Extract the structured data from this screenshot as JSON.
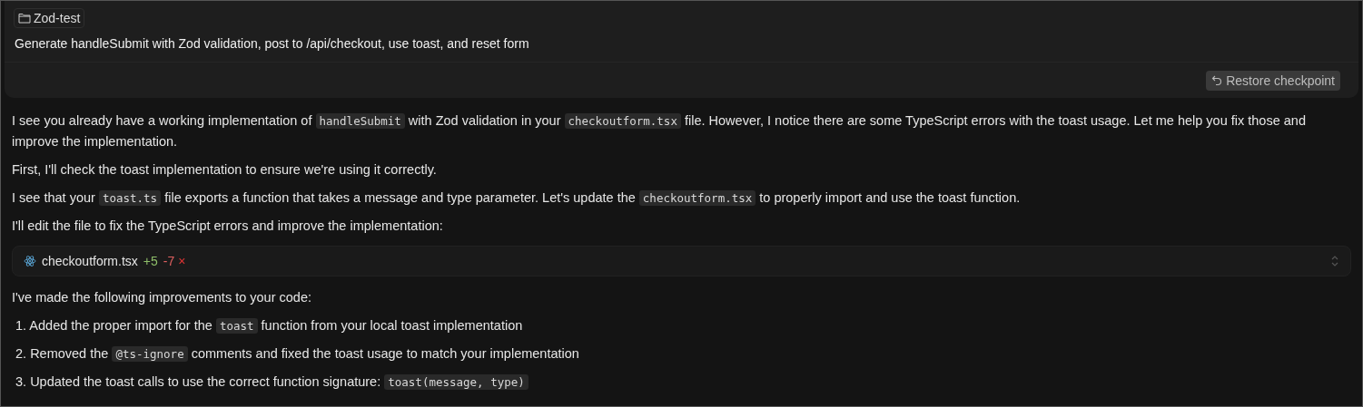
{
  "prompt_card": {
    "folder_chip": "Zod-test",
    "message": "Generate handleSubmit with Zod validation, post to /api/checkout, use toast, and reset form",
    "restore_button": "Restore checkpoint"
  },
  "response": {
    "paragraphs": [
      [
        {
          "kind": "text",
          "text": "I see you already have a working implementation of "
        },
        {
          "kind": "code",
          "text": "handleSubmit"
        },
        {
          "kind": "text",
          "text": " with Zod validation in your "
        },
        {
          "kind": "code",
          "text": "checkoutform.tsx"
        },
        {
          "kind": "text",
          "text": " file. However, I notice there are some TypeScript errors with the toast usage. Let me help you fix those and improve the implementation."
        }
      ],
      [
        {
          "kind": "text",
          "text": "First, I'll check the toast implementation to ensure we're using it correctly."
        }
      ],
      [
        {
          "kind": "text",
          "text": "I see that your "
        },
        {
          "kind": "code",
          "text": "toast.ts"
        },
        {
          "kind": "text",
          "text": " file exports a function that takes a message and type parameter. Let's update the "
        },
        {
          "kind": "code",
          "text": "checkoutform.tsx"
        },
        {
          "kind": "text",
          "text": " to properly import and use the toast function."
        }
      ],
      [
        {
          "kind": "text",
          "text": "I'll edit the file to fix the TypeScript errors and improve the implementation:"
        }
      ]
    ],
    "file_change": {
      "filename": "checkoutform.tsx",
      "added": "+5",
      "removed": "-7",
      "rejected_mark": "×"
    },
    "summary": [
      {
        "kind": "text",
        "text": "I've made the following improvements to your code:"
      }
    ],
    "list_items": [
      {
        "number": "1.",
        "segments": [
          {
            "kind": "text",
            "text": "Added the proper import for the "
          },
          {
            "kind": "code",
            "text": "toast"
          },
          {
            "kind": "text",
            "text": " function from your local toast implementation"
          }
        ]
      },
      {
        "number": "2.",
        "segments": [
          {
            "kind": "text",
            "text": "Removed the "
          },
          {
            "kind": "code",
            "text": "@ts-ignore"
          },
          {
            "kind": "text",
            "text": " comments and fixed the toast usage to match your implementation"
          }
        ]
      },
      {
        "number": "3.",
        "segments": [
          {
            "kind": "text",
            "text": "Updated the toast calls to use the correct function signature: "
          },
          {
            "kind": "code",
            "text": "toast(message, type)"
          }
        ]
      }
    ]
  }
}
